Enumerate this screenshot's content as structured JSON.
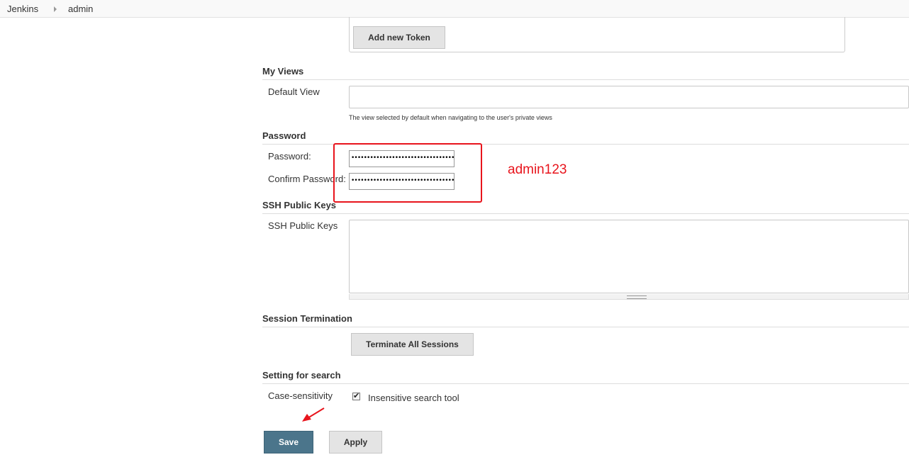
{
  "breadcrumb": {
    "items": [
      "Jenkins",
      "admin"
    ]
  },
  "api_token": {
    "add_button_label": "Add new Token"
  },
  "my_views": {
    "header": "My Views",
    "default_view_label": "Default View",
    "default_view_value": "",
    "help_text": "The view selected by default when navigating to the user's private views"
  },
  "password": {
    "header": "Password",
    "password_label": "Password:",
    "password_value": "••••••••••••••••••••••••••••••••••••••••••••••",
    "confirm_label": "Confirm Password:",
    "confirm_value": "••••••••••••••••••••••••••••••••••••••••••••••"
  },
  "annotation": {
    "note": "admin123",
    "color": "#e8141c"
  },
  "ssh": {
    "header": "SSH Public Keys",
    "label": "SSH Public Keys",
    "value": ""
  },
  "session": {
    "header": "Session Termination",
    "terminate_button_label": "Terminate All Sessions"
  },
  "search": {
    "header": "Setting for search",
    "case_label": "Case-sensitivity",
    "checkbox_label": "Insensitive search tool",
    "checkbox_checked": true
  },
  "actions": {
    "save_label": "Save",
    "apply_label": "Apply"
  },
  "colors": {
    "primary_button": "#4b758b",
    "annotation_red": "#e8141c"
  }
}
